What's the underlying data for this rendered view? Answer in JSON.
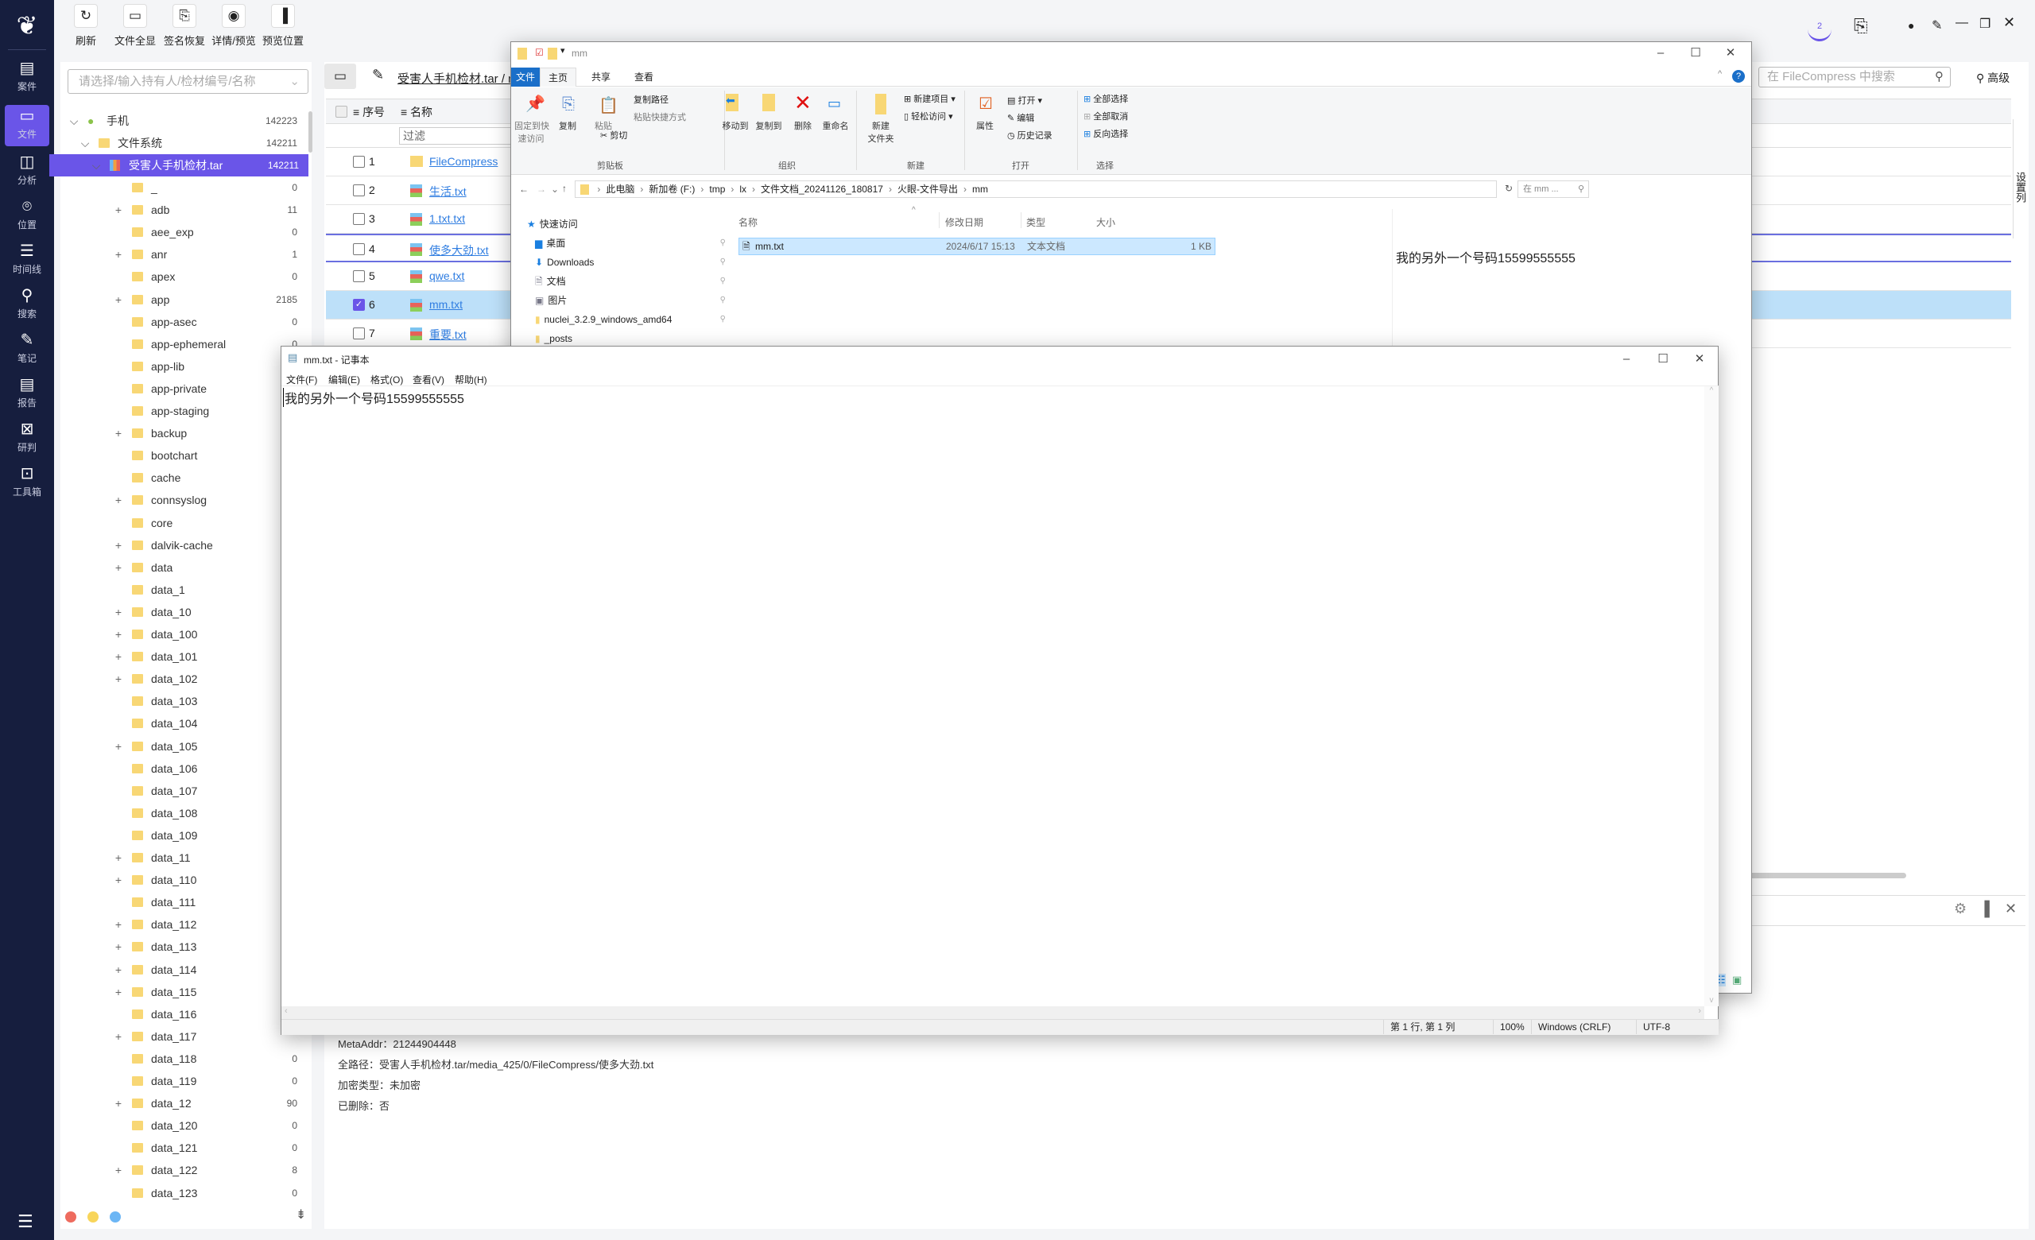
{
  "nav": {
    "items": [
      {
        "label": "案件",
        "icon": "case-icon",
        "glyph": "▤"
      },
      {
        "label": "文件",
        "icon": "file-icon",
        "glyph": "▭",
        "active": true
      },
      {
        "label": "分析",
        "icon": "analysis-icon",
        "glyph": "◫"
      },
      {
        "label": "位置",
        "icon": "location-icon",
        "glyph": "⌾"
      },
      {
        "label": "时间线",
        "icon": "timeline-icon",
        "glyph": "☰"
      },
      {
        "label": "搜索",
        "icon": "search-icon",
        "glyph": "⚲"
      },
      {
        "label": "笔记",
        "icon": "note-icon",
        "glyph": "✎"
      },
      {
        "label": "报告",
        "icon": "report-icon",
        "glyph": "▤"
      },
      {
        "label": "研判",
        "icon": "judge-icon",
        "glyph": "⊠"
      },
      {
        "label": "工具箱",
        "icon": "toolbox-icon",
        "glyph": "⊡"
      }
    ],
    "menu_icon": "hamburger-icon"
  },
  "toolbar": {
    "buttons": [
      {
        "label": "刷新",
        "icon": "refresh-icon",
        "glyph": "↻"
      },
      {
        "label": "文件全显",
        "icon": "folder-icon",
        "glyph": "▭"
      },
      {
        "label": "签名恢复",
        "icon": "signature-restore-icon",
        "glyph": "⎘"
      },
      {
        "label": "详情/预览",
        "icon": "eye-off-icon",
        "glyph": "◉"
      },
      {
        "label": "预览位置",
        "icon": "panel-icon",
        "glyph": "▐"
      }
    ]
  },
  "topright": {
    "badge": "2"
  },
  "tree": {
    "placeholder": "请选择/输入持有人/检材编号/名称",
    "root": {
      "label": "手机",
      "count": "142223"
    },
    "fs": {
      "label": "文件系统",
      "count": "142211"
    },
    "tar": {
      "label": "受害人手机检材.tar",
      "count": "142211"
    },
    "items": [
      {
        "label": "_",
        "count": "0"
      },
      {
        "label": "adb",
        "count": "11",
        "exp": true
      },
      {
        "label": "aee_exp",
        "count": "0"
      },
      {
        "label": "anr",
        "count": "1",
        "exp": true
      },
      {
        "label": "apex",
        "count": "0"
      },
      {
        "label": "app",
        "count": "2185",
        "exp": true
      },
      {
        "label": "app-asec",
        "count": "0"
      },
      {
        "label": "app-ephemeral",
        "count": "0"
      },
      {
        "label": "app-lib"
      },
      {
        "label": "app-private"
      },
      {
        "label": "app-staging"
      },
      {
        "label": "backup",
        "exp": true
      },
      {
        "label": "bootchart"
      },
      {
        "label": "cache"
      },
      {
        "label": "connsyslog",
        "exp": true
      },
      {
        "label": "core"
      },
      {
        "label": "dalvik-cache",
        "exp": true
      },
      {
        "label": "data",
        "count": "1",
        "exp": true
      },
      {
        "label": "data_1"
      },
      {
        "label": "data_10",
        "exp": true
      },
      {
        "label": "data_100",
        "exp": true
      },
      {
        "label": "data_101",
        "exp": true
      },
      {
        "label": "data_102",
        "exp": true
      },
      {
        "label": "data_103"
      },
      {
        "label": "data_104"
      },
      {
        "label": "data_105",
        "exp": true
      },
      {
        "label": "data_106"
      },
      {
        "label": "data_107"
      },
      {
        "label": "data_108"
      },
      {
        "label": "data_109"
      },
      {
        "label": "data_11",
        "exp": true
      },
      {
        "label": "data_110",
        "exp": true
      },
      {
        "label": "data_111"
      },
      {
        "label": "data_112",
        "exp": true
      },
      {
        "label": "data_113",
        "exp": true
      },
      {
        "label": "data_114",
        "exp": true
      },
      {
        "label": "data_115",
        "exp": true
      },
      {
        "label": "data_116"
      },
      {
        "label": "data_117",
        "exp": true
      },
      {
        "label": "data_118",
        "count": "0"
      },
      {
        "label": "data_119",
        "count": "0"
      },
      {
        "label": "data_12",
        "count": "90",
        "exp": true
      },
      {
        "label": "data_120",
        "count": "0"
      },
      {
        "label": "data_121",
        "count": "0"
      },
      {
        "label": "data_122",
        "count": "8",
        "exp": true
      },
      {
        "label": "data_123",
        "count": "0"
      }
    ],
    "dots": [
      "#ee6b5e",
      "#f8d55a",
      "#6cb6f5"
    ]
  },
  "main": {
    "breadcrumb": "受害人手机检材.tar / m",
    "search_placeholder": "在 FileCompress 中搜索",
    "advanced": "高级",
    "columns": {
      "index": "序号",
      "name": "名称"
    },
    "filter": "过滤",
    "column_settings": "设置列",
    "rows": [
      {
        "index": "1",
        "name": "FileCompress",
        "type": "folder"
      },
      {
        "index": "2",
        "name": "生活.txt"
      },
      {
        "index": "3",
        "name": "1.txt.txt"
      },
      {
        "index": "4",
        "name": "使多大劲.txt",
        "focus": true
      },
      {
        "index": "5",
        "name": "qwe.txt"
      },
      {
        "index": "6",
        "name": "mm.txt",
        "selected": true,
        "checked": true
      },
      {
        "index": "7",
        "name": "重要.txt"
      }
    ],
    "details": {
      "meta": "MetaAddr：21244904448",
      "path": "全路径：受害人手机检材.tar/media_425/0/FileCompress/使多大劲.txt",
      "enc": "加密类型：未加密",
      "deleted": "已删除：否"
    }
  },
  "explorer": {
    "title": "mm",
    "tabs": [
      "文件",
      "主页",
      "共享",
      "查看"
    ],
    "ribbon": {
      "pin": "固定到快\n速访问",
      "copy": "复制",
      "paste": "粘贴",
      "copy_path": "复制路径",
      "paste_shortcut": "粘贴快捷方式",
      "cut": "剪切",
      "clipboard": "剪贴板",
      "move_to": "移动到",
      "copy_to": "复制到",
      "delete": "删除",
      "rename": "重命名",
      "organize": "组织",
      "new_folder": "新建\n文件夹",
      "new_item": "新建项目",
      "easy_access": "轻松访问",
      "new": "新建",
      "properties": "属性",
      "open": "打开",
      "edit": "编辑",
      "history": "历史记录",
      "open_group": "打开",
      "select_all": "全部选择",
      "select_none": "全部取消",
      "invert": "反向选择",
      "select": "选择"
    },
    "address": [
      "此电脑",
      "新加卷 (F:)",
      "tmp",
      "lx",
      "文件文档_20241126_180817",
      "火眼-文件导出",
      "mm"
    ],
    "search_placeholder": "在 mm ...",
    "nav": [
      "快速访问",
      "桌面",
      "Downloads",
      "文档",
      "图片",
      "nuclei_3.2.9_windows_amd64",
      "_posts"
    ],
    "headers": {
      "name": "名称",
      "date": "修改日期",
      "type": "类型",
      "size": "大小"
    },
    "file": {
      "name": "mm.txt",
      "date": "2024/6/17 15:13",
      "type": "文本文档",
      "size": "1 KB"
    },
    "preview": "我的另外一个号码15599555555"
  },
  "notepad": {
    "title": "mm.txt - 记事本",
    "menu": [
      "文件(F)",
      "编辑(E)",
      "格式(O)",
      "查看(V)",
      "帮助(H)"
    ],
    "content": "我的另外一个号码15599555555",
    "status": {
      "pos": "第 1 行, 第 1 列",
      "zoom": "100%",
      "eol": "Windows (CRLF)",
      "enc": "UTF-8"
    }
  }
}
